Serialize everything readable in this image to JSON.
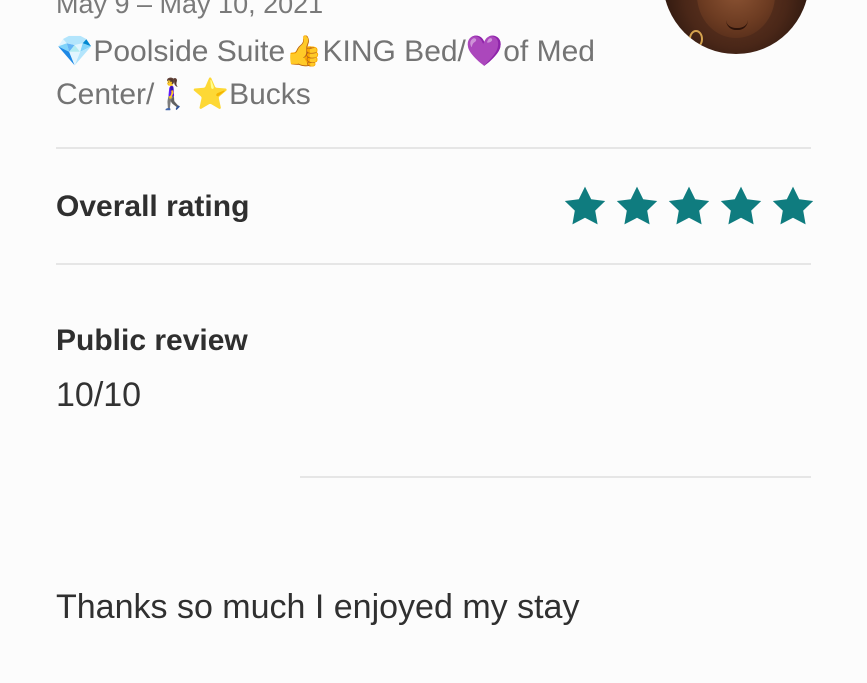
{
  "stay": {
    "dates": "May 9 – May 10, 2021",
    "listing_title": "💎Poolside Suite👍KING Bed/💜of Med Center/🚶‍♀️⭐Bucks"
  },
  "rating": {
    "label": "Overall rating",
    "stars": 5,
    "max_stars": 5,
    "star_color": "#0f7c7f"
  },
  "review": {
    "label": "Public review",
    "score": "10/10",
    "text": "Thanks so much I enjoyed my stay"
  }
}
